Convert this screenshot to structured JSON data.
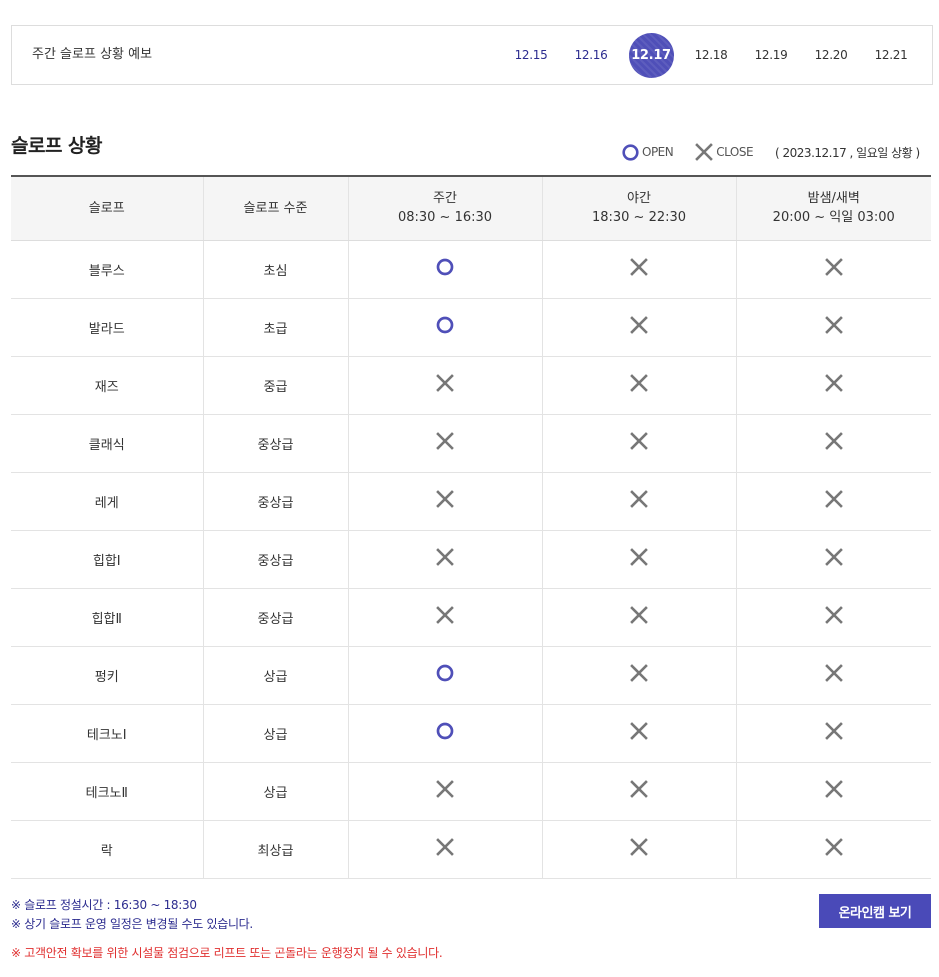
{
  "forecast": {
    "title": "주간 슬로프 상황 예보",
    "dates": [
      "12.15",
      "12.16",
      "12.17",
      "12.18",
      "12.19",
      "12.20",
      "12.21"
    ],
    "active_index": 2
  },
  "section": {
    "title": "슬로프 상황",
    "legend_open": "OPEN",
    "legend_close": "CLOSE",
    "as_of": "( 2023.12.17 , 일요일 상황 )"
  },
  "colors": {
    "accent": "#4f4fb8",
    "close_mark": "#777777",
    "warning": "#e03030"
  },
  "table": {
    "headers": [
      {
        "title": "슬로프",
        "sub": ""
      },
      {
        "title": "슬로프 수준",
        "sub": ""
      },
      {
        "title": "주간",
        "sub": "08:30 ~ 16:30"
      },
      {
        "title": "야간",
        "sub": "18:30 ~ 22:30"
      },
      {
        "title": "밤샘/새벽",
        "sub": "20:00 ~ 익일 03:00"
      }
    ],
    "rows": [
      {
        "slope": "블루스",
        "level": "초심",
        "day": "open",
        "night": "close",
        "dawn": "close"
      },
      {
        "slope": "발라드",
        "level": "초급",
        "day": "open",
        "night": "close",
        "dawn": "close"
      },
      {
        "slope": "재즈",
        "level": "중급",
        "day": "close",
        "night": "close",
        "dawn": "close"
      },
      {
        "slope": "클래식",
        "level": "중상급",
        "day": "close",
        "night": "close",
        "dawn": "close"
      },
      {
        "slope": "레게",
        "level": "중상급",
        "day": "close",
        "night": "close",
        "dawn": "close"
      },
      {
        "slope": "힙합Ⅰ",
        "level": "중상급",
        "day": "close",
        "night": "close",
        "dawn": "close"
      },
      {
        "slope": "힙합Ⅱ",
        "level": "중상급",
        "day": "close",
        "night": "close",
        "dawn": "close"
      },
      {
        "slope": "펑키",
        "level": "상급",
        "day": "open",
        "night": "close",
        "dawn": "close"
      },
      {
        "slope": "테크노Ⅰ",
        "level": "상급",
        "day": "open",
        "night": "close",
        "dawn": "close"
      },
      {
        "slope": "테크노Ⅱ",
        "level": "상급",
        "day": "close",
        "night": "close",
        "dawn": "close"
      },
      {
        "slope": "락",
        "level": "최상급",
        "day": "close",
        "night": "close",
        "dawn": "close"
      }
    ]
  },
  "notes": {
    "line1": "※ 슬로프 정설시간 : 16:30 ~ 18:30",
    "line2": "※ 상기 슬로프 운영 일정은 변경될 수도 있습니다.",
    "warning": "※ 고객안전 확보를 위한 시설물 점검으로 리프트 또는 곤돌라는 운행정지 될 수 있습니다."
  },
  "webcam_button": "온라인캠 보기"
}
